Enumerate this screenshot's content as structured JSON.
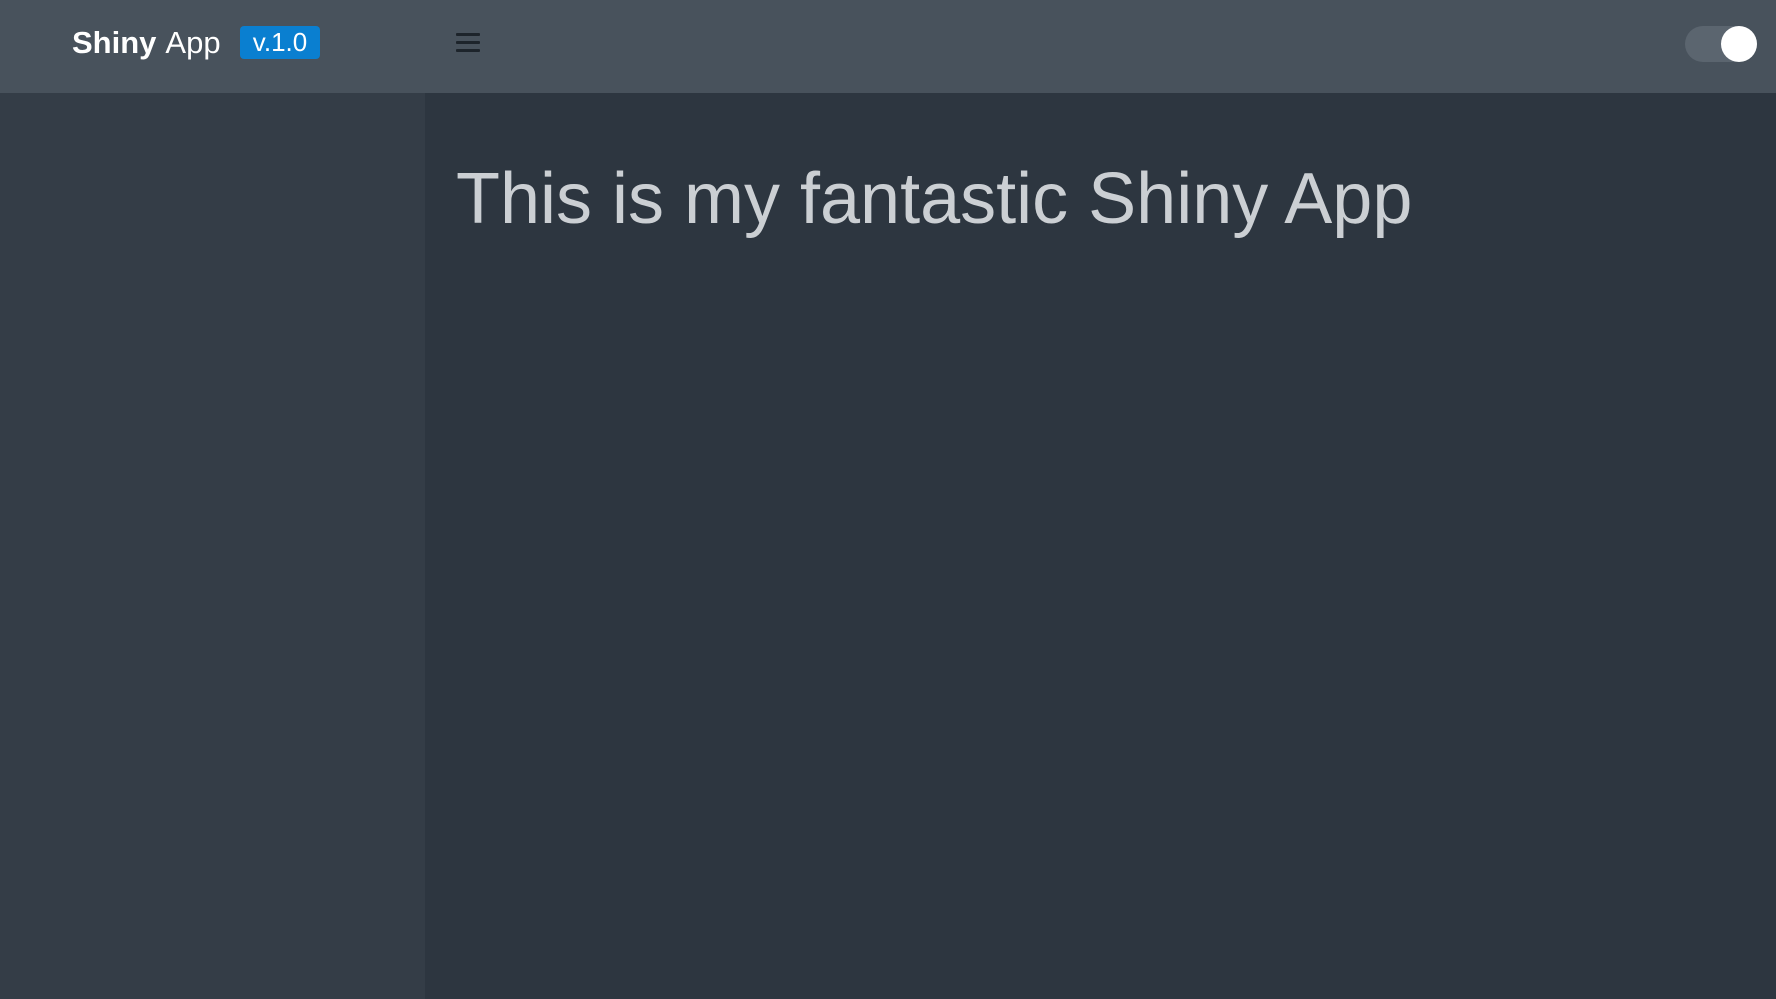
{
  "header": {
    "brand_bold": "Shiny",
    "brand_normal": "App",
    "version": "v.1.0",
    "menu_icon": "hamburger-icon",
    "theme_toggle": {
      "state": "on"
    }
  },
  "main": {
    "title": "This is my fantastic Shiny App"
  },
  "colors": {
    "navbar": "#48525c",
    "sidebar": "#343d47",
    "content": "#2d3640",
    "badge": "#0a7fd0"
  }
}
